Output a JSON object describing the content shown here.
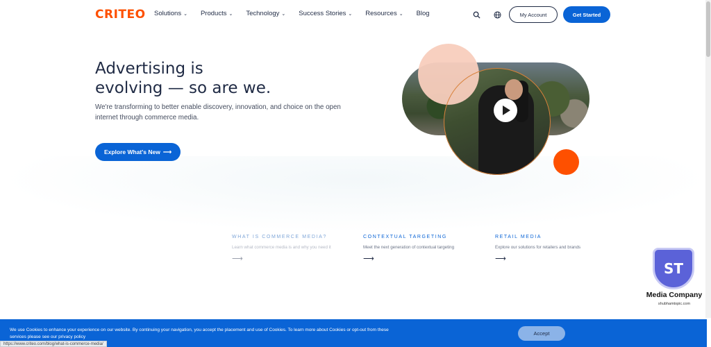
{
  "brand": {
    "logo": "CRITEO",
    "accent": "#fe5000",
    "primary": "#0a64d6"
  },
  "nav": {
    "items": [
      {
        "label": "Solutions",
        "dropdown": true
      },
      {
        "label": "Products",
        "dropdown": true
      },
      {
        "label": "Technology",
        "dropdown": true
      },
      {
        "label": "Success Stories",
        "dropdown": true
      },
      {
        "label": "Resources",
        "dropdown": true
      },
      {
        "label": "Blog",
        "dropdown": false
      }
    ],
    "search_icon": "search-icon",
    "language_icon": "globe-icon",
    "my_account": "My Account",
    "get_started": "Get Started"
  },
  "hero": {
    "title_line1": "Advertising is",
    "title_line2": "evolving — so are we.",
    "subtitle": "We're transforming to better enable discovery, innovation, and choice on the open internet through commerce media.",
    "cta": "Explore What's New",
    "cta_arrow": "⟶",
    "video_icon": "play-icon"
  },
  "features": [
    {
      "title": "What is Commerce Media?",
      "desc": "Learn what commerce media is and why you need it",
      "arrow": "⟶"
    },
    {
      "title": "Contextual Targeting",
      "desc": "Meet the next generation of contextual targeting",
      "arrow": "⟶"
    },
    {
      "title": "Retail Media",
      "desc": "Explore our solutions for retailers and brands",
      "arrow": "⟶"
    }
  ],
  "watermark": {
    "initials": "ST",
    "title": "Media Company",
    "url": "shubhamtopic.com"
  },
  "cookie": {
    "text": "We use Cookies to enhance your experience on our website. By continuing your navigation, you accept the placement and use of Cookies. To learn more about Cookies or opt-out from these services please see our privacy policy",
    "accept": "Accept"
  },
  "status_bar": {
    "url": "https://www.criteo.com/blog/what-is-commerce-media/"
  }
}
